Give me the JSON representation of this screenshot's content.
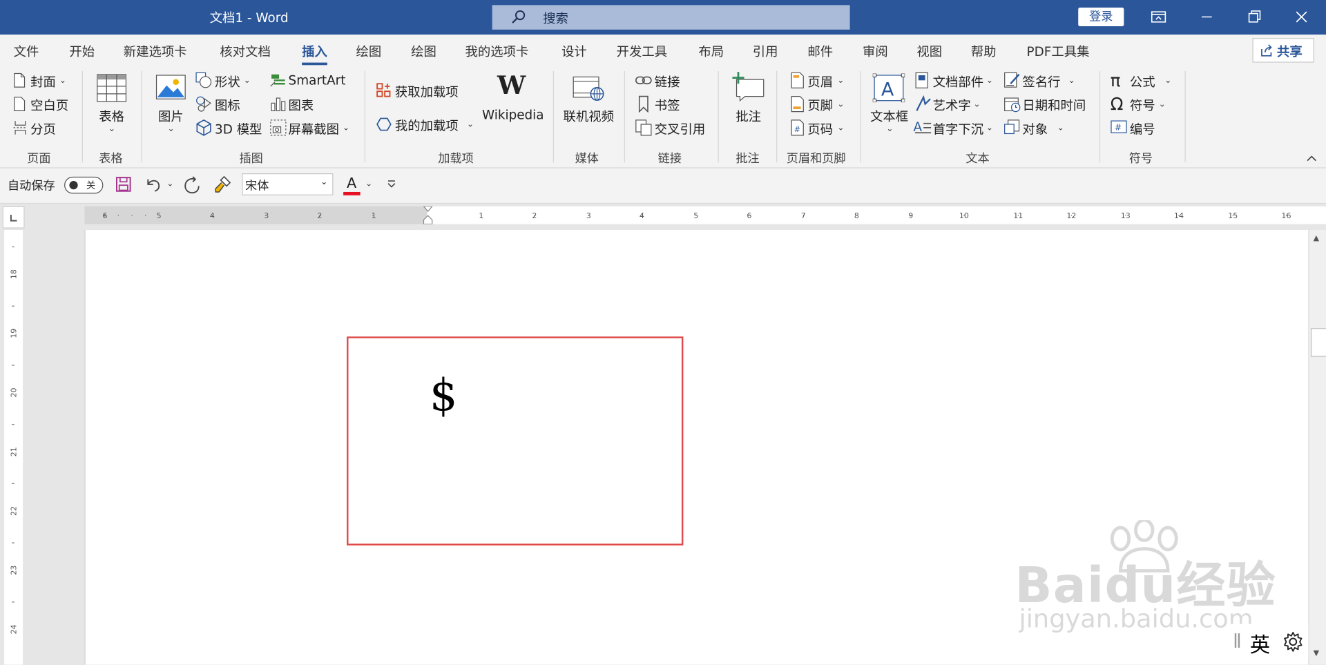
{
  "titlebar": {
    "doc_title": "文档1  -  Word",
    "search_placeholder": "搜索",
    "login_label": "登录"
  },
  "tabs": [
    "文件",
    "开始",
    "新建选项卡",
    "核对文档",
    "插入",
    "绘图",
    "绘图",
    "我的选项卡",
    "设计",
    "开发工具",
    "布局",
    "引用",
    "邮件",
    "审阅",
    "视图",
    "帮助",
    "PDF工具集"
  ],
  "active_tab": "插入",
  "share_label": "共享",
  "ribbon": {
    "pages": {
      "group": "页面",
      "cover": "封面",
      "blank": "空白页",
      "break": "分页"
    },
    "tables": {
      "group": "表格",
      "table": "表格"
    },
    "illustrations": {
      "group": "插图",
      "picture": "图片",
      "shapes": "形状",
      "icons": "图标",
      "model3d": "3D 模型",
      "smartart": "SmartArt",
      "chart": "图表",
      "screenshot": "屏幕截图"
    },
    "addins": {
      "group": "加载项",
      "get": "获取加载项",
      "my": "我的加载项",
      "wikipedia": "Wikipedia"
    },
    "media": {
      "group": "媒体",
      "online_video": "联机视频"
    },
    "links": {
      "group": "链接",
      "link": "链接",
      "bookmark": "书签",
      "crossref": "交叉引用"
    },
    "comments": {
      "group": "批注",
      "comment": "批注"
    },
    "header_footer": {
      "group": "页眉和页脚",
      "header": "页眉",
      "footer": "页脚",
      "page_number": "页码"
    },
    "text": {
      "group": "文本",
      "textbox": "文本框",
      "quick_parts": "文档部件",
      "wordart": "艺术字",
      "dropcap": "首字下沉",
      "signature": "签名行",
      "datetime": "日期和时间",
      "object": "对象"
    },
    "symbols": {
      "group": "符号",
      "equation": "公式",
      "symbol": "符号",
      "number": "编号"
    }
  },
  "qat": {
    "autosave_label": "自动保存",
    "autosave_state": "关",
    "font_name": "宋体"
  },
  "document": {
    "textbox_content": "$"
  },
  "ime": {
    "mode": "英"
  },
  "watermark": {
    "main": "Baidu经验",
    "sub": "jingyan.baidu.com"
  },
  "colors": {
    "word_blue": "#2b579a",
    "textbox_border": "#e04a4a",
    "font_color_bar": "#e81123"
  }
}
